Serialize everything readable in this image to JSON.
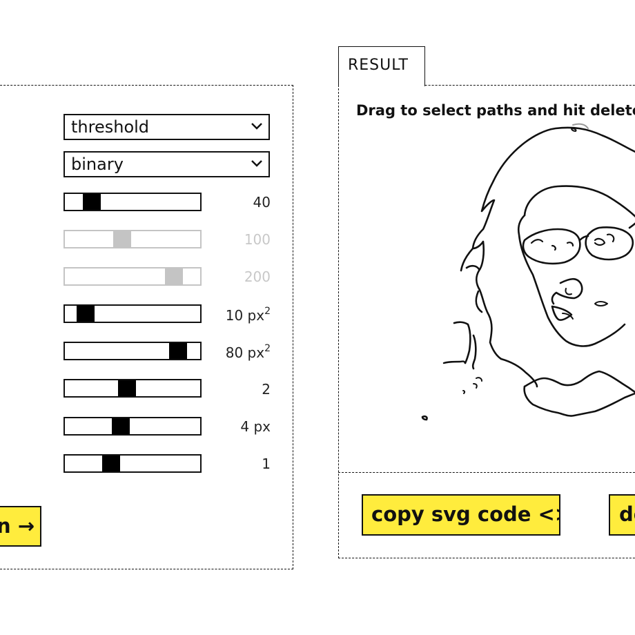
{
  "settings": {
    "mode_select": "threshold",
    "type_select": "binary",
    "sliders": [
      {
        "value": "40",
        "position": 0.15,
        "disabled": false
      },
      {
        "value": "100",
        "position": 0.41,
        "disabled": true
      },
      {
        "value": "200",
        "position": 0.85,
        "disabled": true
      },
      {
        "value": "10 px",
        "sup": "2",
        "position": 0.1,
        "disabled": false
      },
      {
        "value": "80 px",
        "sup": "2",
        "position": 0.89,
        "disabled": false
      },
      {
        "value": "2",
        "position": 0.45,
        "disabled": false
      },
      {
        "value": "4 px",
        "position": 0.4,
        "disabled": false
      },
      {
        "value": "1",
        "position": 0.32,
        "disabled": false
      }
    ],
    "action_button": "n →"
  },
  "result": {
    "tab_label": "RESULT",
    "instruction": "Drag to select paths and hit delete",
    "copy_button": "copy svg code <>",
    "second_button": "do"
  },
  "colors": {
    "accent": "#ffec3d",
    "disabled": "#c4c4c4",
    "border": "#111111"
  }
}
